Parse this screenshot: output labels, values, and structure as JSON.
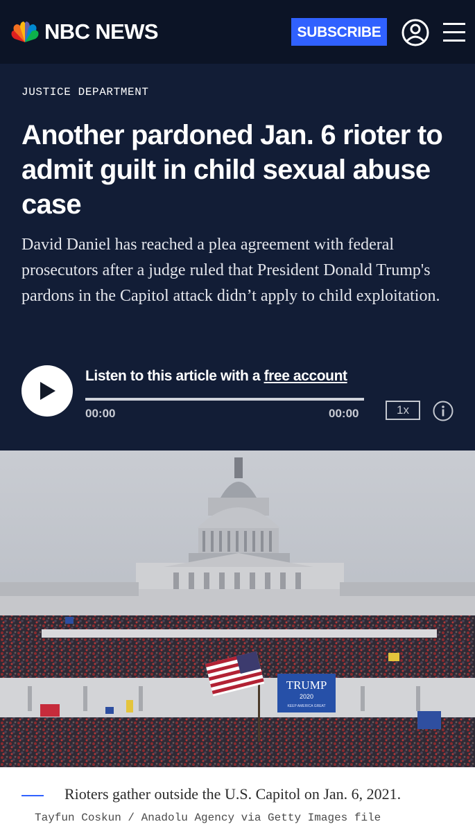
{
  "header": {
    "brand": "NBC NEWS",
    "subscribe_label": "SUBSCRIBE",
    "account_icon": "user-circle-icon",
    "menu_icon": "hamburger-menu-icon"
  },
  "article": {
    "kicker": "JUSTICE DEPARTMENT",
    "headline": "Another pardoned Jan. 6 rioter to admit guilt in child sexual abuse case",
    "dek": "David Daniel has reached a plea agreement with federal prosecutors after a judge ruled that President Donald Trump's pardons in the Capitol attack didn’t apply to child exploitation."
  },
  "audio_player": {
    "prompt": "Listen to this article with a",
    "link_text": "free account",
    "current_time": "00:00",
    "duration": "00:00",
    "speed": "1x",
    "progress": 0,
    "play_icon": "play-icon",
    "info_icon": "info-icon"
  },
  "photo": {
    "banner_text": "TRUMP",
    "banner_year": "2020",
    "banner_tagline": "KEEP AMERICA GREAT",
    "caption": "Rioters gather outside the U.S. Capitol on Jan. 6, 2021.",
    "credit": "Tayfun Coskun / Anadolu Agency via Getty Images file"
  },
  "colors": {
    "nav_background": "#0c1426",
    "hero_background": "#121d36",
    "accent_blue": "#3061ff",
    "text_light": "#ffffff"
  }
}
